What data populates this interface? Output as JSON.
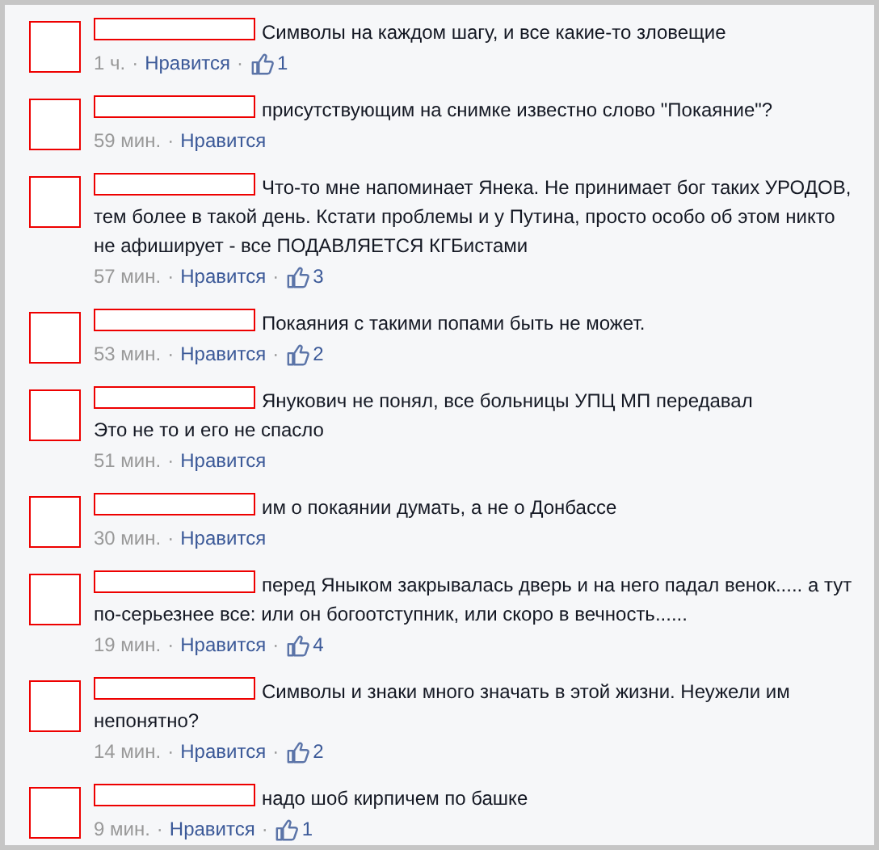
{
  "comments": [
    {
      "text": "Символы на каждом шагу, и все какие-то зловещие",
      "time": "1 ч.",
      "separator": "·",
      "like_label": "Нравится",
      "likes": "1"
    },
    {
      "text": "присутствующим на снимке известно слово \"Покаяние\"?",
      "time": "59 мин.",
      "separator": "·",
      "like_label": "Нравится"
    },
    {
      "text": "Что-то мне напоминает Янека. Не принимает бог таких УРОДОВ, тем более в такой день. Кстати проблемы и у Путина, просто особо об этом никто не афиширует - все ПОДАВЛЯЕТСЯ КГБистами",
      "time": "57 мин.",
      "separator": "·",
      "like_label": "Нравится",
      "likes": "3"
    },
    {
      "text": "Покаяния с такими попами быть не может.",
      "time": "53 мин.",
      "separator": "·",
      "like_label": "Нравится",
      "likes": "2"
    },
    {
      "text": "Янукович не понял, все больницы УПЦ МП передавал\n Это не то и его не спасло",
      "time": "51 мин.",
      "separator": "·",
      "like_label": "Нравится"
    },
    {
      "text": "им о покаянии думать, а не о Донбассе",
      "time": "30 мин.",
      "separator": "·",
      "like_label": "Нравится"
    },
    {
      "text": "перед Яныком закрывалась дверь и на него падал венок..... а тут по-серьезнее все: или он богоотступник, или скоро в вечность......",
      "time": "19 мин.",
      "separator": "·",
      "like_label": "Нравится",
      "likes": "4"
    },
    {
      "text": "Символы и знаки много значать в этой жизни. Неужели им непонятно?",
      "time": "14 мин.",
      "separator": "·",
      "like_label": "Нравится",
      "likes": "2"
    },
    {
      "text": "надо шоб кирпичем по башке",
      "time": "9 мин.",
      "separator": "·",
      "like_label": "Нравится",
      "likes": "1"
    }
  ]
}
